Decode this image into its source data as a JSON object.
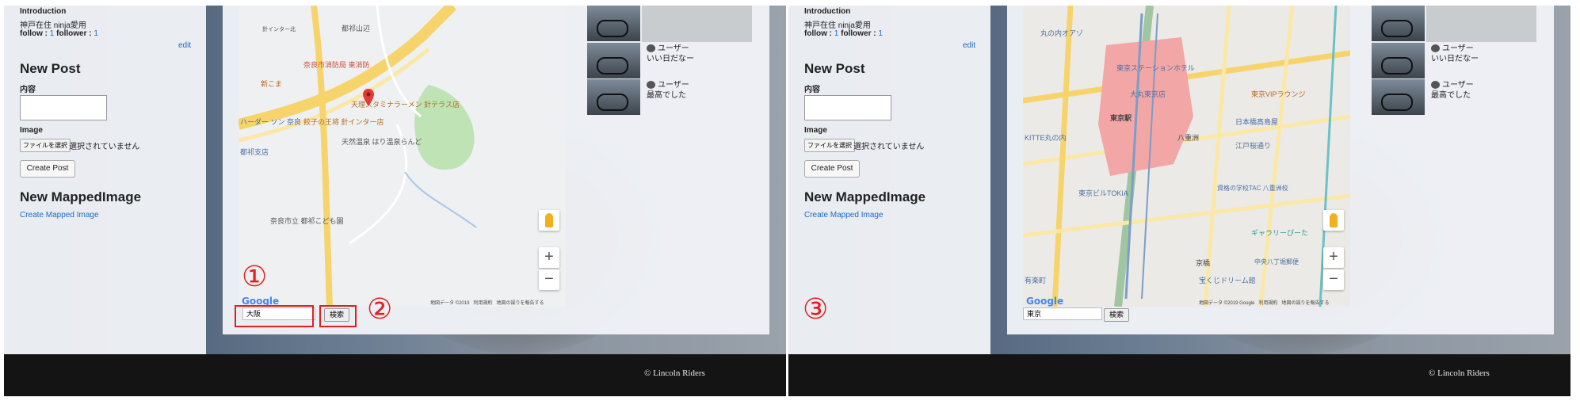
{
  "sidebar": {
    "intro_title": "Introduction",
    "intro_text": "神戸在住 ninja愛用",
    "follow_label": "follow :",
    "follow_count": "1",
    "follower_label": "follower :",
    "follower_count": "1",
    "edit_link": "edit",
    "new_post_heading": "New Post",
    "content_label": "内容",
    "image_label": "Image",
    "file_button": "ファイルを選択",
    "file_status": "選択されていません",
    "create_post_button": "Create Post",
    "mapped_heading": "New MappedImage",
    "mapped_link": "Create Mapped Image"
  },
  "posts": [
    {
      "user": "ユーザー",
      "text": "いい日だなー"
    },
    {
      "user": "ユーザー",
      "text": "最高でした"
    }
  ],
  "panels": [
    {
      "search_value": "大阪",
      "search_button": "検索",
      "annotations": [
        "①",
        "②"
      ],
      "map_labels": [
        "奈良市消防局 東消防",
        "天理スタミナラーメン 針テラス店",
        "餃子の王将 針インター店",
        "天然温泉 はり温泉らんど",
        "奈良市立 都祁こども園",
        "都祁山辺",
        "針インター北",
        "新こま",
        "都祁支店",
        "ハーダー ソン 奈良"
      ]
    },
    {
      "search_value": "東京",
      "search_button": "検索",
      "annotations": [
        "③"
      ],
      "map_labels": [
        "丸の内オアゾ",
        "東京ステーションホテル",
        "大丸東京店",
        "東京駅",
        "KITTE丸の内",
        "東京ビルTOKIA",
        "八重洲",
        "江戸桜通り",
        "京橋",
        "宝くじドリーム館",
        "ギャラリーぴーた",
        "日本橋髙島屋",
        "中央八丁堀郵便",
        "東京VIPラウンジ",
        "有楽町",
        "資格の学校TAC 八重洲校"
      ]
    }
  ],
  "map": {
    "attribution_1": "地図データ ©2019",
    "attribution_1b": "地図データ ©2019 Google",
    "terms": "利用規約",
    "report": "地図の誤りを報告する",
    "google_logo": "Google",
    "zoom_in": "+",
    "zoom_out": "−"
  },
  "footer": {
    "copyright": "© Lincoln Riders"
  },
  "colors": {
    "annotation_red": "#e02020",
    "link_blue": "#1a6bc4",
    "footer_bg": "#141414"
  }
}
